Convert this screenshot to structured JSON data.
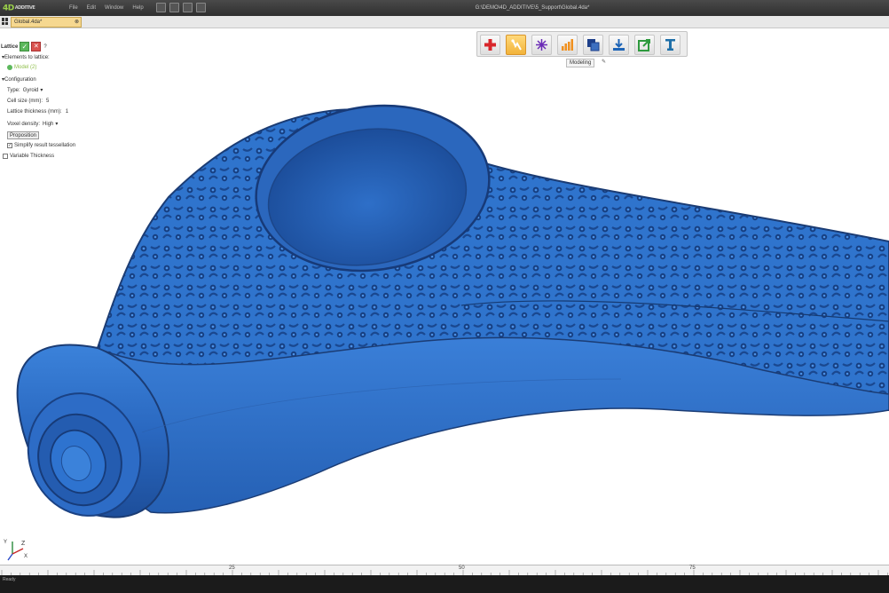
{
  "app": {
    "logo_text": "4D",
    "logo_sub": "ADDITIVE",
    "menu": [
      "File",
      "Edit",
      "Window",
      "Help"
    ],
    "window_title": "G:\\DEMO\\4D_ADDITIVE\\5_Support\\Global.4da*"
  },
  "tabs": {
    "active_doc": "Global.4da*",
    "close_glyph": "⊗"
  },
  "panel": {
    "title": "Lattice",
    "ok_glyph": "✓",
    "cancel_glyph": "✕",
    "help_glyph": "?",
    "elements_label": "Elements to lattice:",
    "model_item": "Model (2)",
    "configuration": "Configuration",
    "type_label": "Type:",
    "type_value": "Gyroid",
    "cell_size_label": "Cell size (mm):",
    "cell_size_value": "5",
    "thickness_label": "Lattice thickness (mm):",
    "thickness_value": "1",
    "voxel_label": "Voxel density:",
    "voxel_value": "High",
    "proposition_label": "Proposition",
    "simplify_label": "Simplify result tessellation",
    "simplify_checked": true,
    "variable_label": "Variable Thickness",
    "variable_checked": false
  },
  "toolbar": {
    "tools": [
      {
        "icon": "plus-icon",
        "color": "#d8262b"
      },
      {
        "icon": "pointer-hand-icon",
        "color": "#f2b33a",
        "active": true
      },
      {
        "icon": "starburst-icon",
        "color": "#6a2ab6"
      },
      {
        "icon": "bar-chart-icon",
        "color": "#f0901e"
      },
      {
        "icon": "layers-icon",
        "color": "#1d3f8a"
      },
      {
        "icon": "download-icon",
        "color": "#1e64b6"
      },
      {
        "icon": "export-icon",
        "color": "#2e9a3e"
      },
      {
        "icon": "support-pillar-icon",
        "color": "#1e6fa8"
      }
    ],
    "tooltip": "Modeling"
  },
  "viewport": {
    "model_color": "#2b6dc4"
  },
  "axis": {
    "z": "Z",
    "y": "Y",
    "x": "X"
  },
  "ruler": {
    "ticks": [
      "25",
      "50",
      "75"
    ]
  },
  "status": {
    "text": "Ready"
  }
}
